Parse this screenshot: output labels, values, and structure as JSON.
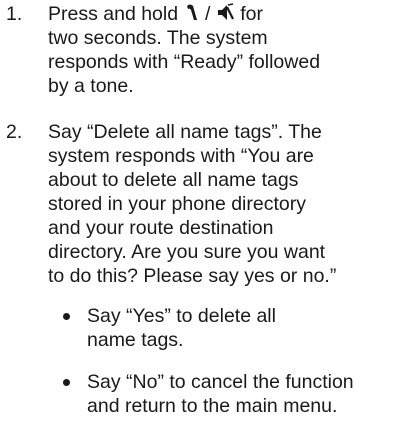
{
  "steps": [
    {
      "number": "1.",
      "line1_before_icons": "Press and hold",
      "icon_separator": "/",
      "line1_after_icons": "for",
      "lines": [
        "two seconds. The system",
        "responds with “Ready” followed",
        "by a tone."
      ],
      "icons": [
        "voice-command-icon",
        "mute-icon"
      ]
    },
    {
      "number": "2.",
      "lines": [
        "Say “Delete all name tags”. The",
        "system responds with “You are",
        "about to delete all name tags",
        "stored in your phone directory",
        "and your route destination",
        "directory. Are you sure you want",
        "to do this? Please say yes or no.”"
      ],
      "bullets": [
        {
          "lines": [
            "Say “Yes” to delete all",
            "name tags."
          ]
        },
        {
          "lines": [
            "Say “No” to cancel the function",
            "and return to the main menu."
          ]
        }
      ]
    }
  ]
}
